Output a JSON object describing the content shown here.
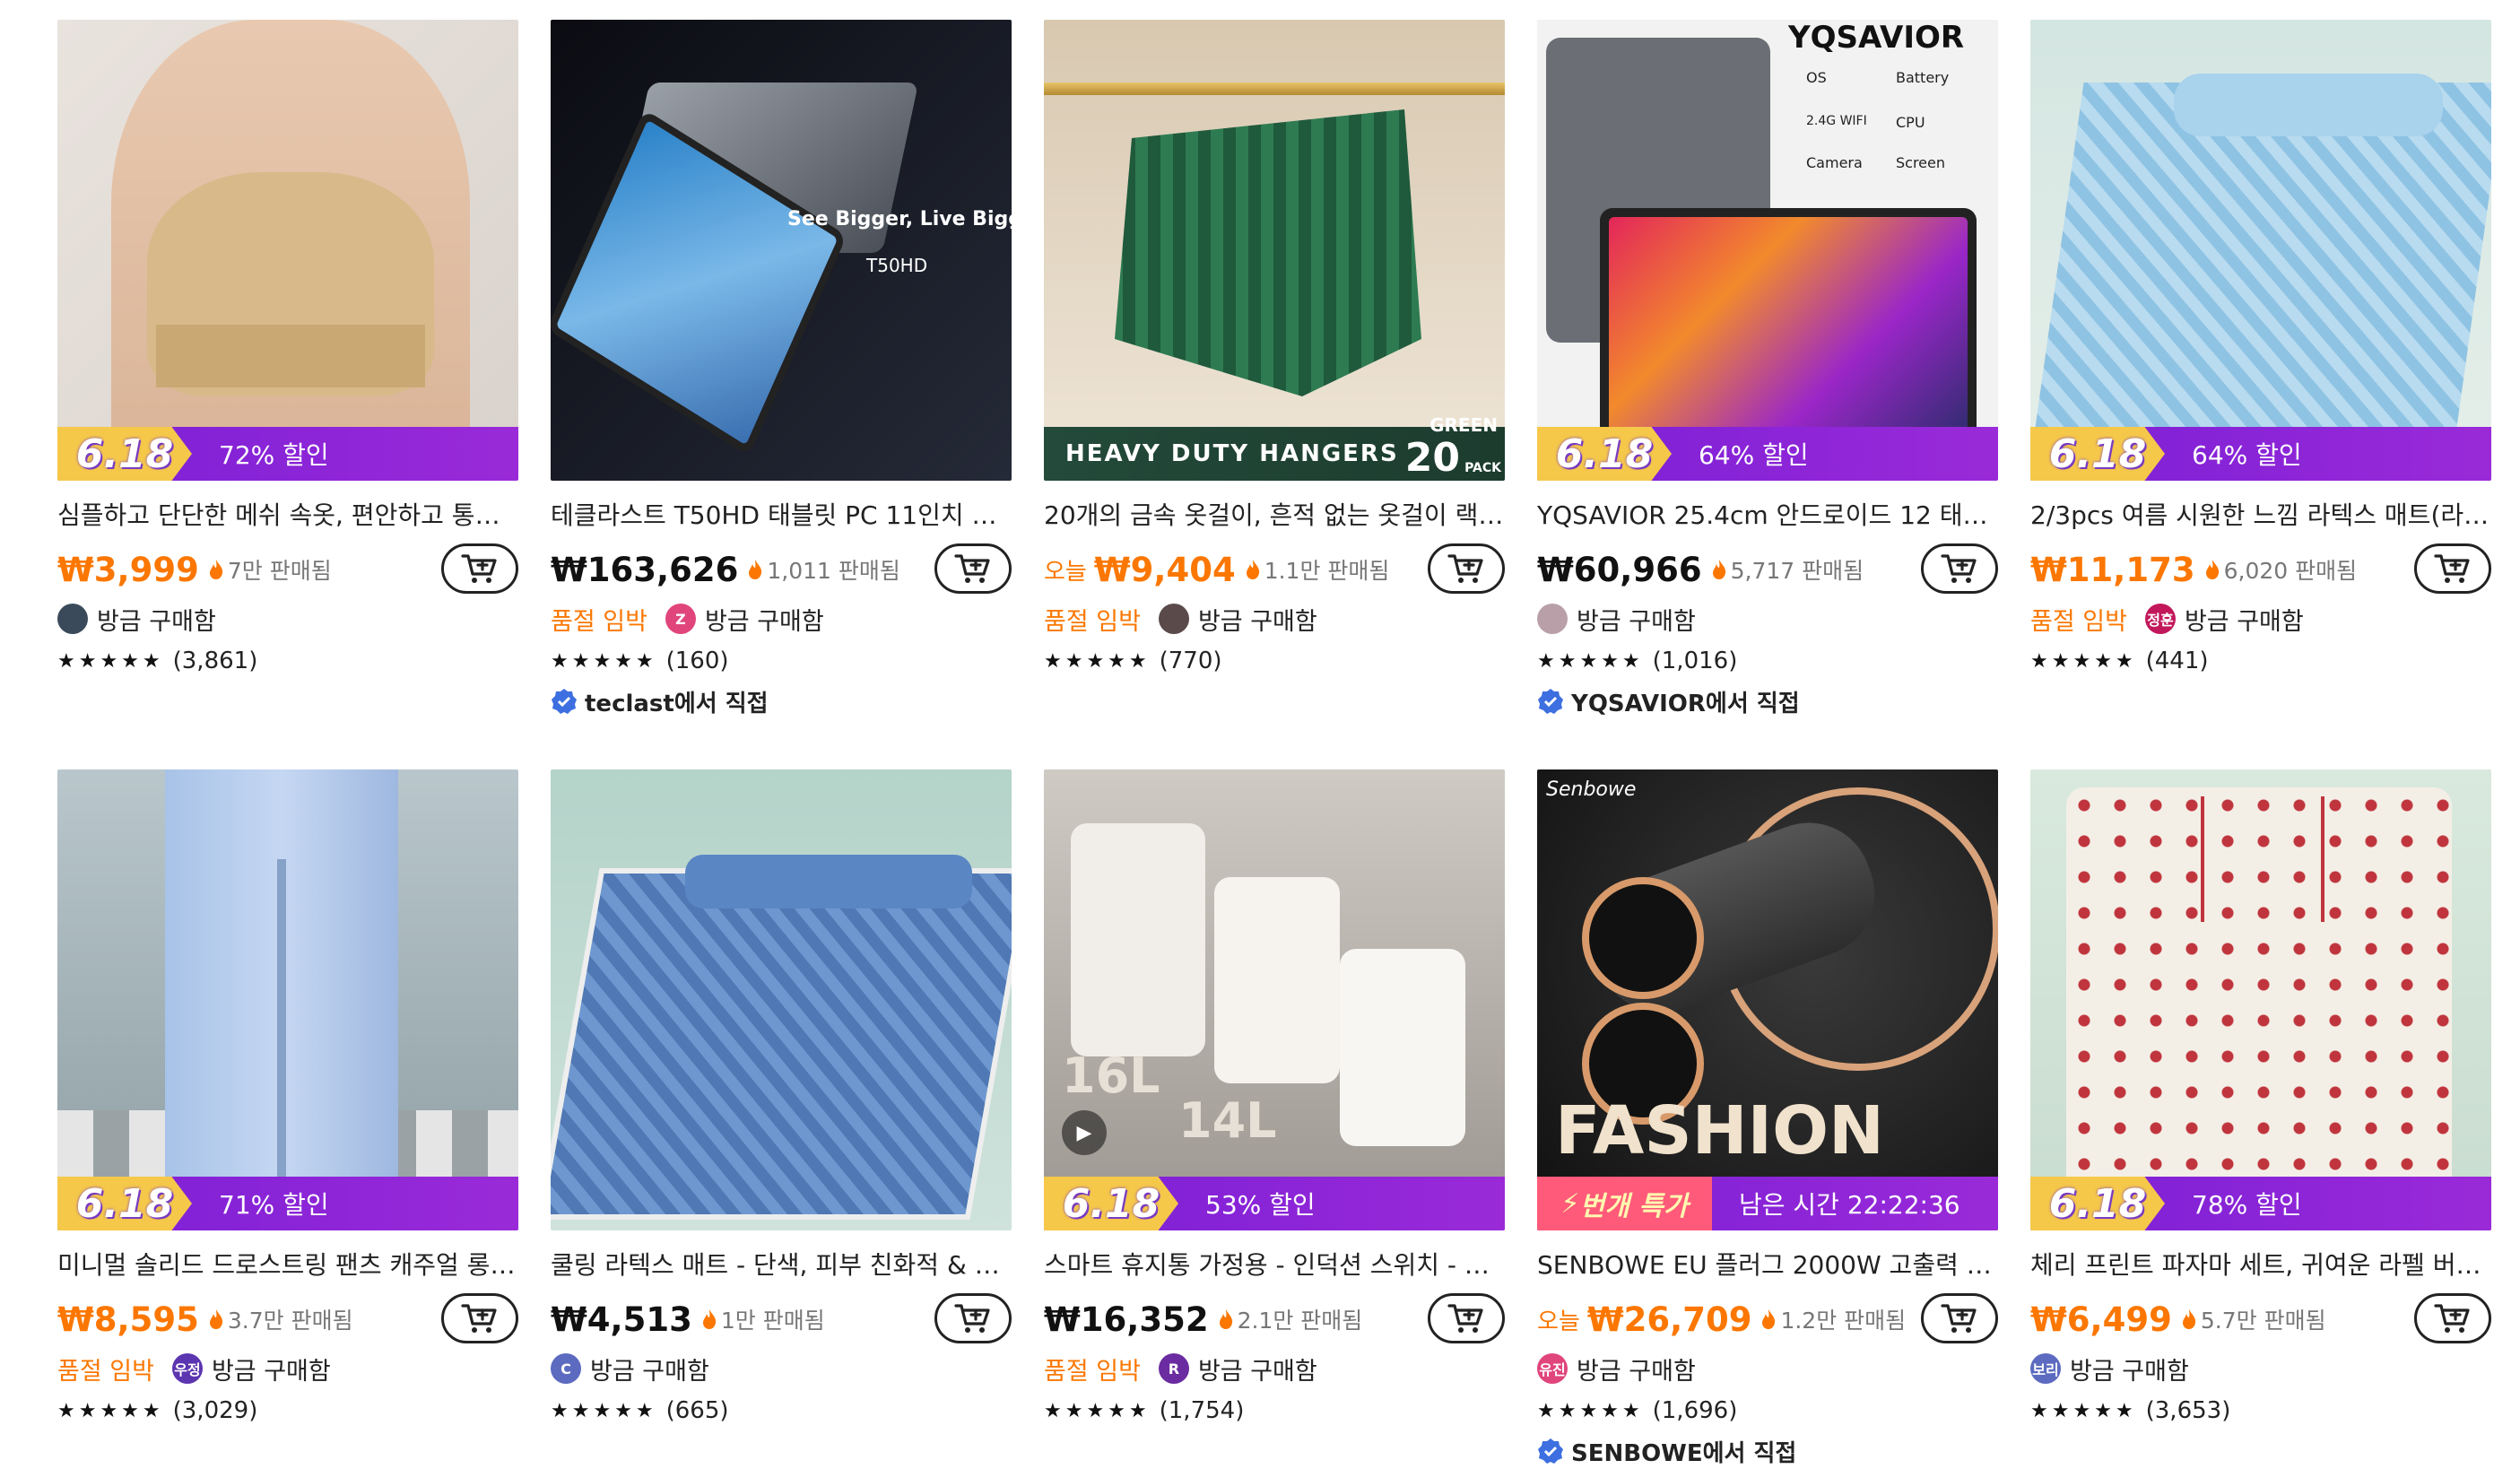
{
  "colors": {
    "accent": "#fb7701",
    "promo_bar": "#8a24d8"
  },
  "products": [
    {
      "title": "심플하고 단단한 메쉬 속옷, 편안하고 통기성 ...",
      "price": "₩3,999",
      "price_style": "orange",
      "today": "",
      "sold": "7만 판매됨",
      "promo": "6.18",
      "promo_text": "72% 할인",
      "badge": "",
      "buyer": "방금 구매함",
      "avatar_letter": "",
      "avatar_color": "#3a4a5a",
      "stars": "★★★★★",
      "reviews": "(3,861)",
      "direct": ""
    },
    {
      "title": "테클라스트 T50HD 태블릿 PC 11인치 TD...",
      "price": "₩163,626",
      "price_style": "black",
      "today": "",
      "sold": "1,011 판매됨",
      "promo": "",
      "promo_text": "",
      "badge": "품절 임박",
      "buyer": "방금 구매함",
      "avatar_letter": "Z",
      "avatar_color": "#e0457b",
      "stars": "★★★★★",
      "reviews": "(160)",
      "direct": "teclast에서 직접"
    },
    {
      "title": "20개의 금속 옷걸이, 흔적 없는 옷걸이 랙, ...",
      "price": "₩9,404",
      "price_style": "orange",
      "today": "오늘",
      "sold": "1.1만 판매됨",
      "promo": "",
      "promo_text": "",
      "badge": "품절 임박",
      "buyer": "방금 구매함",
      "avatar_letter": "",
      "avatar_color": "#5a4a4a",
      "stars": "★★★★★",
      "reviews": "(770)",
      "direct": ""
    },
    {
      "title": "YQSAVIOR 25.4cm 안드로이드 12 태블릿...",
      "price": "₩60,966",
      "price_style": "black",
      "today": "",
      "sold": "5,717 판매됨",
      "promo": "6.18",
      "promo_text": "64% 할인",
      "badge": "",
      "buyer": "방금 구매함",
      "avatar_letter": "",
      "avatar_color": "#b9a0a8",
      "stars": "★★★★★",
      "reviews": "(1,016)",
      "direct": "YQSAVIOR에서 직접"
    },
    {
      "title": "2/3pcs 여름 시원한 느낌 라텍스 매트(라텍...",
      "price": "₩11,173",
      "price_style": "orange",
      "today": "",
      "sold": "6,020 판매됨",
      "promo": "6.18",
      "promo_text": "64% 할인",
      "badge": "품절 임박",
      "buyer": "방금 구매함",
      "avatar_letter": "정훈",
      "avatar_color": "#c2185b",
      "stars": "★★★★★",
      "reviews": "(441)",
      "direct": ""
    },
    {
      "title": "미니멀 솔리드 드로스트링 팬츠 캐주얼 롱기...",
      "price": "₩8,595",
      "price_style": "orange",
      "today": "",
      "sold": "3.7만 판매됨",
      "promo": "6.18",
      "promo_text": "71% 할인",
      "badge": "품절 임박",
      "buyer": "방금 구매함",
      "avatar_letter": "우정",
      "avatar_color": "#5c35b0",
      "stars": "★★★★★",
      "reviews": "(3,029)",
      "direct": ""
    },
    {
      "title": "쿨링 라텍스 매트 - 단색, 피부 친화적 & 세탁...",
      "price": "₩4,513",
      "price_style": "black",
      "today": "",
      "sold": "1만 판매됨",
      "promo": "",
      "promo_text": "",
      "badge": "",
      "buyer": "방금 구매함",
      "avatar_letter": "C",
      "avatar_color": "#5c6bc0",
      "stars": "★★★★★",
      "reviews": "(665)",
      "direct": ""
    },
    {
      "title": "스마트 휴지통 가정용 - 인덕션 스위치 - 부...",
      "price": "₩16,352",
      "price_style": "black",
      "today": "",
      "sold": "2.1만 판매됨",
      "promo": "6.18",
      "promo_text": "53% 할인",
      "badge": "품절 임박",
      "buyer": "방금 구매함",
      "avatar_letter": "R",
      "avatar_color": "#6a2ca0",
      "stars": "★★★★★",
      "reviews": "(1,754)",
      "direct": ""
    },
    {
      "title": "SENBOWE EU 플러그 2000W 고출력 블...",
      "price": "₩26,709",
      "price_style": "orange",
      "today": "오늘",
      "sold": "1.2만 판매됨",
      "promo": "번개 특가",
      "promo_text": "남은 시간 22:22:36",
      "badge": "",
      "buyer": "방금 구매함",
      "avatar_letter": "유진",
      "avatar_color": "#e0457b",
      "stars": "★★★★★",
      "reviews": "(1,696)",
      "direct": "SENBOWE에서 직접"
    },
    {
      "title": "체리 프린트 파자마 세트, 귀여운 라펠 버튼 ...",
      "price": "₩6,499",
      "price_style": "orange",
      "today": "",
      "sold": "5.7만 판매됨",
      "promo": "6.18",
      "promo_text": "78% 할인",
      "badge": "",
      "buyer": "방금 구매함",
      "avatar_letter": "보리",
      "avatar_color": "#5c6bc0",
      "stars": "★★★★★",
      "reviews": "(3,653)",
      "direct": ""
    }
  ],
  "image_text": {
    "p2_headline": "See Bigger, Live Bigger",
    "p2_model": "T50HD",
    "p3_banner": "HEAVY DUTY HANGERS",
    "p3_green": "GREEN",
    "p3_pack": "20",
    "p3_pack_unit": "PACK",
    "p4_brand": "YQSAVIOR",
    "p4_os": "OS",
    "p4_battery": "Battery",
    "p4_wifi": "2.4G WIFI",
    "p4_cpu": "CPU",
    "p4_camera": "Camera",
    "p4_screen": "Screen",
    "p8_16l": "16L",
    "p8_14l": "14L",
    "p9_brand": "Senbowe",
    "p9_fashion": "FASHION"
  }
}
